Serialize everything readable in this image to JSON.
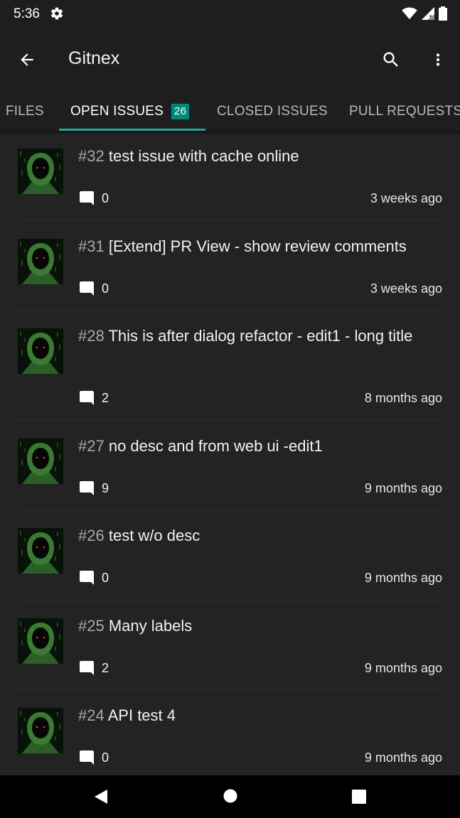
{
  "status_bar": {
    "time": "5:36"
  },
  "app_bar": {
    "title": "Gitnex"
  },
  "tabs": [
    {
      "label": "FILES"
    },
    {
      "label": "OPEN ISSUES",
      "badge": "26"
    },
    {
      "label": "CLOSED ISSUES"
    },
    {
      "label": "PULL REQUESTS"
    }
  ],
  "issues": [
    {
      "number": "#32",
      "title": "test issue with cache online",
      "comments": "0",
      "date": "3 weeks ago"
    },
    {
      "number": "#31",
      "title": "[Extend] PR View - show review comments",
      "comments": "0",
      "date": "3 weeks ago"
    },
    {
      "number": "#28",
      "title": "This is after dialog refactor - edit1 - long title",
      "comments": "2",
      "date": "8 months ago"
    },
    {
      "number": "#27",
      "title": "no desc and from web ui -edit1",
      "comments": "9",
      "date": "9 months ago"
    },
    {
      "number": "#26",
      "title": "test w/o desc",
      "comments": "0",
      "date": "9 months ago"
    },
    {
      "number": "#25",
      "title": "Many labels",
      "comments": "2",
      "date": "9 months ago"
    },
    {
      "number": "#24",
      "title": "API test 4",
      "comments": "0",
      "date": "9 months ago"
    }
  ],
  "colors": {
    "accent": "#26a69a",
    "badge": "#00897b",
    "background": "#1e1e1e",
    "list_background": "#232323"
  },
  "icons": [
    "gear-icon",
    "wifi-icon",
    "signal-icon",
    "battery-icon",
    "back-arrow-icon",
    "search-icon",
    "more-vert-icon",
    "comment-icon",
    "nav-back-icon",
    "nav-home-icon",
    "nav-recents-icon"
  ]
}
